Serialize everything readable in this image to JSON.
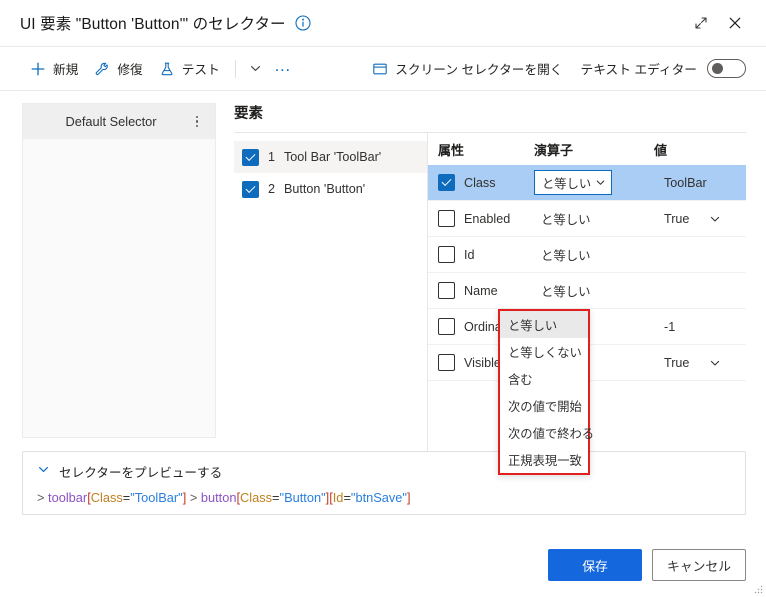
{
  "window": {
    "title": "UI 要素 \"Button 'Button'\" のセレクター",
    "info_icon": "info-icon",
    "expand_icon": "expand-icon",
    "close_icon": "close-icon"
  },
  "commandbar": {
    "new_label": "新規",
    "repair_label": "修復",
    "test_label": "テスト",
    "overflow_label": "…",
    "screen_selector_label": "スクリーン セレクターを開く",
    "text_editor_label": "テキスト エディター",
    "text_editor_on": false
  },
  "selectors_panel": {
    "items": [
      {
        "label": "Default Selector",
        "menu_icon": "kebab-menu-icon"
      }
    ]
  },
  "elements_panel": {
    "title": "要素",
    "items": [
      {
        "index": "1",
        "label": "Tool Bar 'ToolBar'",
        "checked": true,
        "selected": true
      },
      {
        "index": "2",
        "label": "Button 'Button'",
        "checked": true,
        "selected": false
      }
    ]
  },
  "attributes_table": {
    "headers": {
      "attribute": "属性",
      "operator": "演算子",
      "value": "値"
    },
    "rows": [
      {
        "name": "Class",
        "checked": true,
        "selected": true,
        "operator": "と等しい",
        "operator_is_combo": true,
        "value": "ToolBar",
        "value_is_combo": false
      },
      {
        "name": "Enabled",
        "checked": false,
        "selected": false,
        "operator": "と等しい",
        "operator_is_combo": false,
        "value": "True",
        "value_is_combo": true
      },
      {
        "name": "Id",
        "checked": false,
        "selected": false,
        "operator": "と等しい",
        "operator_is_combo": false,
        "value": "",
        "value_is_combo": false
      },
      {
        "name": "Name",
        "checked": false,
        "selected": false,
        "operator": "と等しい",
        "operator_is_combo": false,
        "value": "",
        "value_is_combo": false
      },
      {
        "name": "Ordinal",
        "checked": false,
        "selected": false,
        "operator": "と等しい",
        "operator_is_combo": false,
        "value": "-1",
        "value_is_combo": false
      },
      {
        "name": "Visible",
        "checked": false,
        "selected": false,
        "operator": "と等しい",
        "operator_is_combo": false,
        "value": "True",
        "value_is_combo": true
      }
    ]
  },
  "operator_dropdown": {
    "open": true,
    "highlight_color": "#e02020",
    "selected": "と等しい",
    "options": [
      "と等しい",
      "と等しくない",
      "含む",
      "次の値で開始",
      "次の値で終わる",
      "正規表現一致"
    ]
  },
  "preview": {
    "toggle_label": "セレクターをプレビューする",
    "expanded": true,
    "selector_tokens": [
      {
        "text": ">",
        "type": "arrow"
      },
      {
        "text": "toolbar",
        "type": "tag"
      },
      {
        "text": "[",
        "type": "bracket"
      },
      {
        "text": "Class",
        "type": "attr"
      },
      {
        "text": "=",
        "type": "eq"
      },
      {
        "text": "\"ToolBar\"",
        "type": "value"
      },
      {
        "text": "]",
        "type": "bracket"
      },
      {
        "text": ">",
        "type": "arrow"
      },
      {
        "text": "button",
        "type": "tag"
      },
      {
        "text": "[",
        "type": "bracket"
      },
      {
        "text": "Class",
        "type": "attr"
      },
      {
        "text": "=",
        "type": "eq"
      },
      {
        "text": "\"Button\"",
        "type": "value"
      },
      {
        "text": "]",
        "type": "bracket"
      },
      {
        "text": "[",
        "type": "bracket"
      },
      {
        "text": "Id",
        "type": "attr"
      },
      {
        "text": "=",
        "type": "eq"
      },
      {
        "text": "\"btnSave\"",
        "type": "value"
      },
      {
        "text": "]",
        "type": "bracket"
      }
    ],
    "selector_plain": "> toolbar[Class=\"ToolBar\"] > button[Class=\"Button\"][Id=\"btnSave\"]"
  },
  "footer": {
    "save_label": "保存",
    "cancel_label": "キャンセル"
  },
  "colors": {
    "accent": "#0f6cbd",
    "primary_button": "#1567dd",
    "row_selected": "#a9cdf4",
    "dropdown_border": "#e02020"
  }
}
